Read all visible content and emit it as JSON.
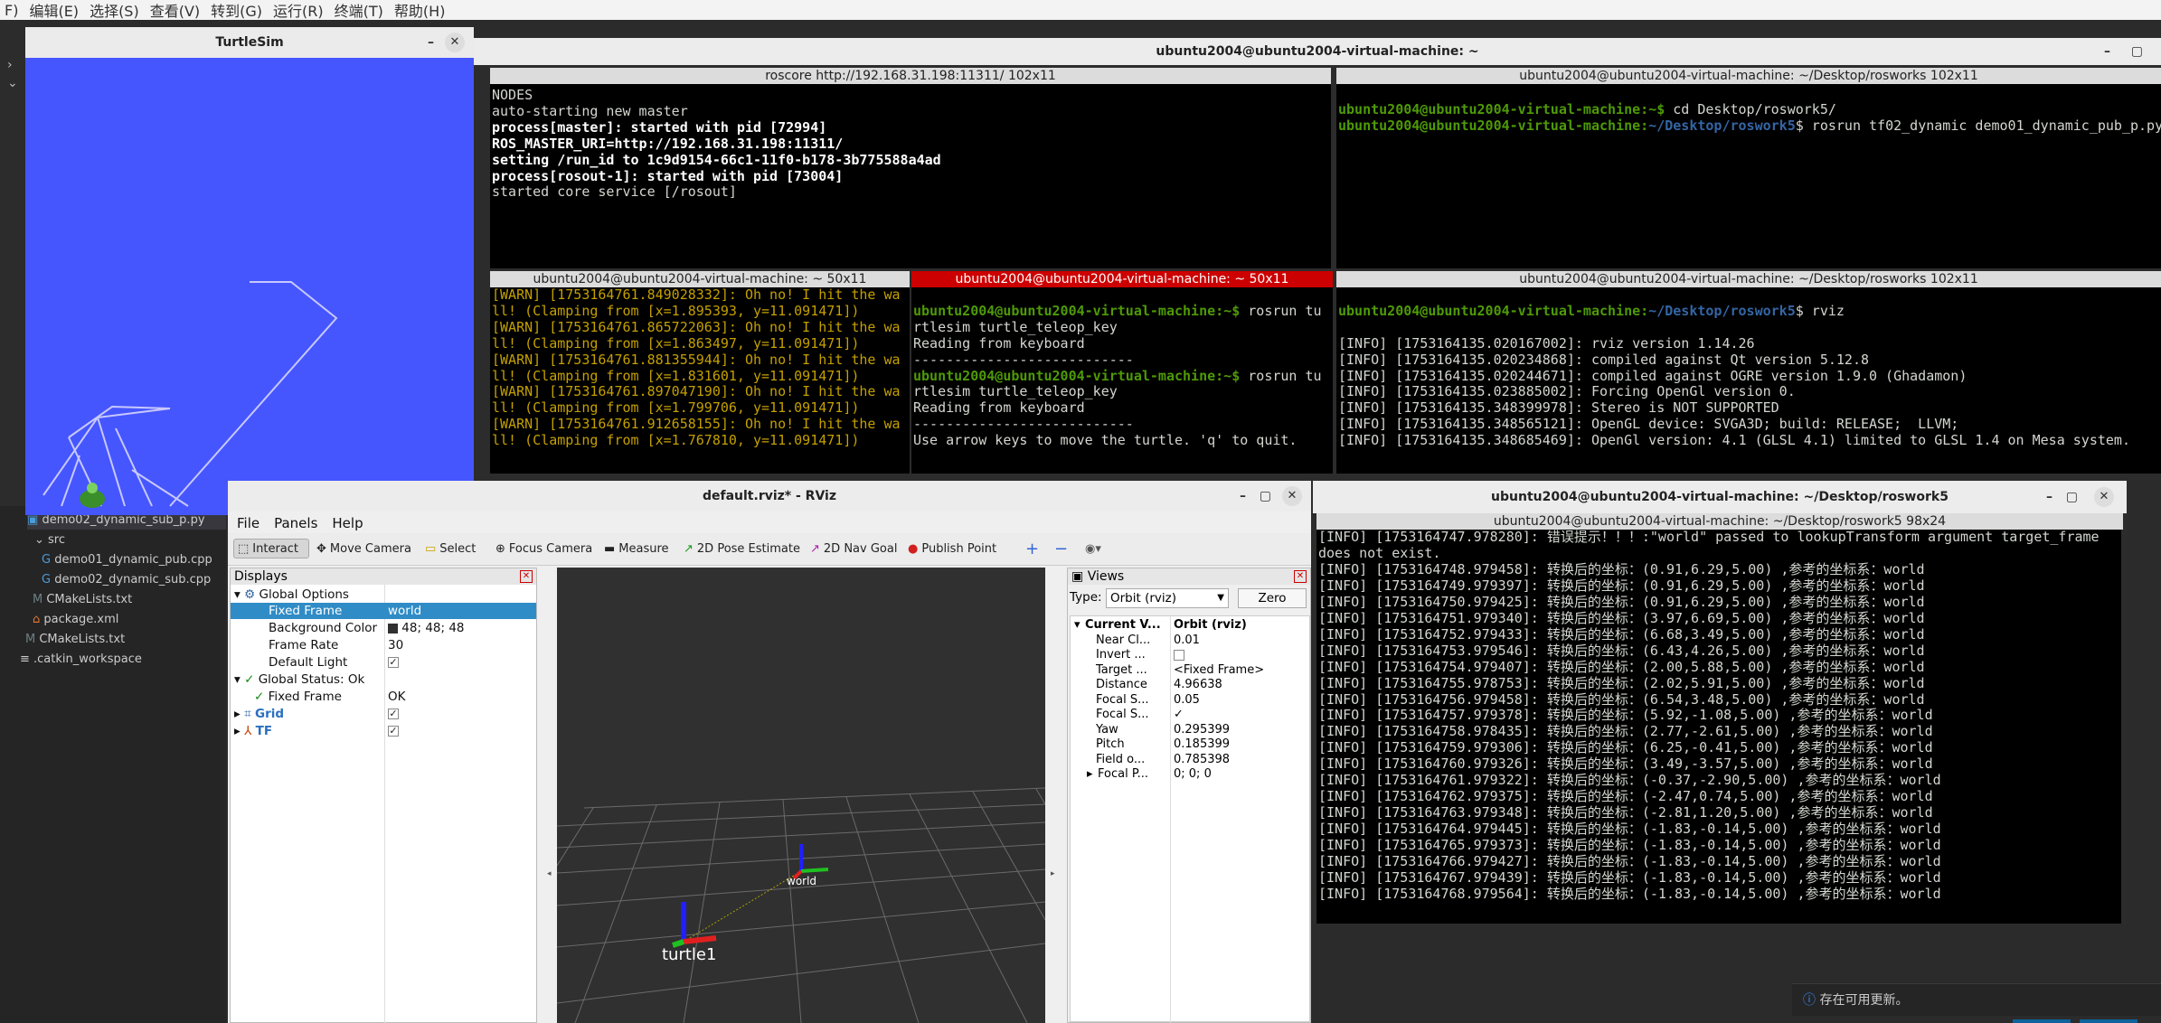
{
  "menubar": {
    "items": [
      "F)",
      "编辑(E)",
      "选择(S)",
      "查看(V)",
      "转到(G)",
      "运行(R)",
      "终端(T)",
      "帮助(H)"
    ]
  },
  "turtlesim": {
    "title": "TurtleSim",
    "bg_color": "#4556ff"
  },
  "explorer": {
    "items": [
      {
        "label": "demo02_dynamic_sub_p.py"
      },
      {
        "label": "src"
      },
      {
        "label": "demo01_dynamic_pub.cpp"
      },
      {
        "label": "demo02_dynamic_sub.cpp"
      },
      {
        "label": "CMakeLists.txt"
      },
      {
        "label": "package.xml"
      },
      {
        "label": "CMakeLists.txt"
      },
      {
        "label": ".catkin_workspace"
      }
    ]
  },
  "main_terminal": {
    "title": "ubuntu2004@ubuntu2004-virtual-machine: ~"
  },
  "t1": {
    "title": "roscore http://192.168.31.198:11311/ 102x11",
    "lines": [
      "",
      "NODES",
      "",
      "auto-starting new master",
      "process[master]: started with pid [72994]",
      "ROS_MASTER_URI=http://192.168.31.198:11311/",
      "",
      "setting /run_id to 1c9d9154-66c1-11f0-b178-3b775588a4ad",
      "process[rosout-1]: started with pid [73004]",
      "started core service [/rosout]"
    ]
  },
  "t2": {
    "title": "ubuntu2004@ubuntu2004-virtual-machine: ~/Desktop/rosworks 102x11",
    "prompt1": "ubuntu2004@ubuntu2004-virtual-machine:~$",
    "cmd1": " cd Desktop/roswork5/",
    "prompt2": "ubuntu2004@ubuntu2004-virtual-machine:",
    "path2": "~/Desktop/roswork5",
    "cmd2": "$ rosrun tf02_dynamic demo01_dynamic_pub_p.py"
  },
  "t3": {
    "title": "ubuntu2004@ubuntu2004-virtual-machine: ~ 50x11",
    "lines": [
      "[WARN] [1753164761.849028332]: Oh no! I hit the wa",
      "ll! (Clamping from [x=1.895393, y=11.091471])",
      "[WARN] [1753164761.865722063]: Oh no! I hit the wa",
      "ll! (Clamping from [x=1.863497, y=11.091471])",
      "[WARN] [1753164761.881355944]: Oh no! I hit the wa",
      "ll! (Clamping from [x=1.831601, y=11.091471])",
      "[WARN] [1753164761.897047190]: Oh no! I hit the wa",
      "ll! (Clamping from [x=1.799706, y=11.091471])",
      "[WARN] [1753164761.912658155]: Oh no! I hit the wa",
      "ll! (Clamping from [x=1.767810, y=11.091471])"
    ]
  },
  "t4": {
    "title": "ubuntu2004@ubuntu2004-virtual-machine: ~ 50x11",
    "prompt": "ubuntu2004@ubuntu2004-virtual-machine:~$",
    "cmd": " rosrun tu",
    "l2": "rtlesim turtle_teleop_key",
    "l3": "Reading from keyboard",
    "l4": "---------------------------",
    "l5": "Use arrow keys to move the turtle. 'q' to quit."
  },
  "t5": {
    "title": "ubuntu2004@ubuntu2004-virtual-machine: ~/Desktop/rosworks 102x11",
    "prompt": "ubuntu2004@ubuntu2004-virtual-machine:",
    "path": "~/Desktop/roswork5",
    "cmd": "$ rviz",
    "lines": [
      "[INFO] [1753164135.020167002]: rviz version 1.14.26",
      "[INFO] [1753164135.020234868]: compiled against Qt version 5.12.8",
      "[INFO] [1753164135.020244671]: compiled against OGRE version 1.9.0 (Ghadamon)",
      "[INFO] [1753164135.023885002]: Forcing OpenGl version 0.",
      "[INFO] [1753164135.348399978]: Stereo is NOT SUPPORTED",
      "[INFO] [1753164135.348565121]: OpenGL device: SVGA3D; build: RELEASE;  LLVM;",
      "[INFO] [1753164135.348685469]: OpenGl version: 4.1 (GLSL 4.1) limited to GLSL 1.4 on Mesa system."
    ]
  },
  "rviz": {
    "title": "default.rviz* - RViz",
    "menu": [
      "File",
      "Panels",
      "Help"
    ],
    "tools": [
      "Interact",
      "Move Camera",
      "Select",
      "Focus Camera",
      "Measure",
      "2D Pose Estimate",
      "2D Nav Goal",
      "Publish Point"
    ],
    "displays_title": "Displays",
    "global_options": "Global Options",
    "fixed_frame_label": "Fixed Frame",
    "fixed_frame_value": "world",
    "bg_color_label": "Background Color",
    "bg_color_value": "48; 48; 48",
    "frame_rate_label": "Frame Rate",
    "frame_rate_value": "30",
    "default_light_label": "Default Light",
    "global_status": "Global Status: Ok",
    "status_fixed_frame": "Fixed Frame",
    "status_ok": "OK",
    "grid": "Grid",
    "tf": "TF",
    "views_title": "Views",
    "type_label": "Type:",
    "type_value": "Orbit (rviz)",
    "zero_button": "Zero",
    "view_props": [
      {
        "k": "Current V...",
        "v": "Orbit (rviz)"
      },
      {
        "k": "Near Cl...",
        "v": "0.01"
      },
      {
        "k": "Invert ...",
        "v": ""
      },
      {
        "k": "Target ...",
        "v": "<Fixed Frame>"
      },
      {
        "k": "Distance",
        "v": "4.96638"
      },
      {
        "k": "Focal S...",
        "v": "0.05"
      },
      {
        "k": "Focal S...",
        "v": "✓"
      },
      {
        "k": "Yaw",
        "v": "0.295399"
      },
      {
        "k": "Pitch",
        "v": "0.185399"
      },
      {
        "k": "Field o...",
        "v": "0.785398"
      },
      {
        "k": "Focal P...",
        "v": "0; 0; 0"
      }
    ],
    "label_world": "world",
    "label_turtle1": "turtle1"
  },
  "t6": {
    "window_title": "ubuntu2004@ubuntu2004-virtual-machine: ~/Desktop/roswork5",
    "title": "ubuntu2004@ubuntu2004-virtual-machine: ~/Desktop/roswork5 98x24",
    "lines": [
      "[INFO] [1753164747.978280]: 错误提示！！！:\"world\" passed to lookupTransform argument target_frame",
      "does not exist.",
      "[INFO] [1753164748.979458]: 转换后的坐标：(0.91,6.29,5.00) ,参考的坐标系：world",
      "[INFO] [1753164749.979397]: 转换后的坐标：(0.91,6.29,5.00) ,参考的坐标系：world",
      "[INFO] [1753164750.979425]: 转换后的坐标：(0.91,6.29,5.00) ,参考的坐标系：world",
      "[INFO] [1753164751.979340]: 转换后的坐标：(3.97,6.69,5.00) ,参考的坐标系：world",
      "[INFO] [1753164752.979433]: 转换后的坐标：(6.68,3.49,5.00) ,参考的坐标系：world",
      "[INFO] [1753164753.979546]: 转换后的坐标：(6.43,4.26,5.00) ,参考的坐标系：world",
      "[INFO] [1753164754.979407]: 转换后的坐标：(2.00,5.88,5.00) ,参考的坐标系：world",
      "[INFO] [1753164755.978753]: 转换后的坐标：(2.02,5.91,5.00) ,参考的坐标系：world",
      "[INFO] [1753164756.979458]: 转换后的坐标：(6.54,3.48,5.00) ,参考的坐标系：world",
      "[INFO] [1753164757.979378]: 转换后的坐标：(5.92,-1.08,5.00) ,参考的坐标系：world",
      "[INFO] [1753164758.978435]: 转换后的坐标：(2.77,-2.61,5.00) ,参考的坐标系：world",
      "[INFO] [1753164759.979306]: 转换后的坐标：(6.25,-0.41,5.00) ,参考的坐标系：world",
      "[INFO] [1753164760.979326]: 转换后的坐标：(3.49,-3.57,5.00) ,参考的坐标系：world",
      "[INFO] [1753164761.979322]: 转换后的坐标：(-0.37,-2.90,5.00) ,参考的坐标系：world",
      "[INFO] [1753164762.979375]: 转换后的坐标：(-2.47,0.74,5.00) ,参考的坐标系：world",
      "[INFO] [1753164763.979348]: 转换后的坐标：(-2.81,1.20,5.00) ,参考的坐标系：world",
      "[INFO] [1753164764.979445]: 转换后的坐标：(-1.83,-0.14,5.00) ,参考的坐标系：world",
      "[INFO] [1753164765.979373]: 转换后的坐标：(-1.83,-0.14,5.00) ,参考的坐标系：world",
      "[INFO] [1753164766.979427]: 转换后的坐标：(-1.83,-0.14,5.00) ,参考的坐标系：world",
      "[INFO] [1753164767.979439]: 转换后的坐标：(-1.83,-0.14,5.00) ,参考的坐标系：world",
      "[INFO] [1753164768.979564]: 转换后的坐标：(-1.83,-0.14,5.00) ,参考的坐标系：world"
    ]
  },
  "notification": {
    "text": "存在可用更新。"
  }
}
